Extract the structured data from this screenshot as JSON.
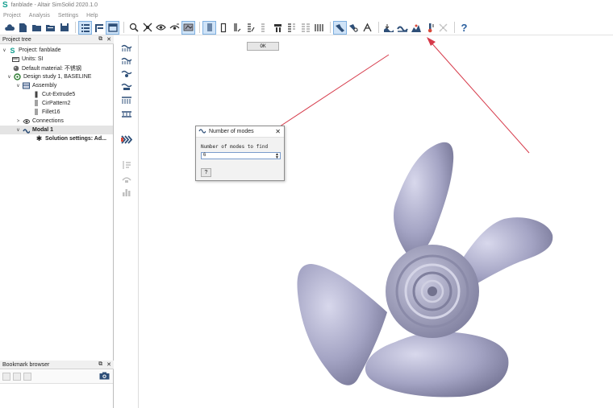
{
  "window": {
    "title": "fanblade - Altair SimSolid 2020.1.0"
  },
  "menu": [
    "Project",
    "Analysis",
    "Settings",
    "Help"
  ],
  "colors": {
    "accent": "#2a5f9e",
    "model": "#a4a4c4",
    "arrow": "#d63a4a",
    "selection": "#cfe3f7"
  },
  "panels": {
    "project_tree_title": "Project tree",
    "bookmark_title": "Bookmark browser",
    "float_glyph": "⧉",
    "close_glyph": "✕"
  },
  "tree": [
    {
      "label": "Project: fanblade",
      "icon": "simsolid-logo-icon",
      "twisty": "∨"
    },
    {
      "label": "Units: SI",
      "icon": "units-icon",
      "twisty": ""
    },
    {
      "label": "Default material: 不锈钢",
      "icon": "material-icon",
      "twisty": ""
    },
    {
      "label": "Design study 1, BASELINE",
      "icon": "design-study-icon",
      "twisty": "∨"
    },
    {
      "label": "Assembly",
      "icon": "assembly-icon",
      "twisty": "∨"
    },
    {
      "label": "Cut-Extrude5",
      "icon": "part-icon",
      "twisty": ""
    },
    {
      "label": "CirPattern2",
      "icon": "part-icon",
      "twisty": ""
    },
    {
      "label": "Fillet16",
      "icon": "part-icon",
      "twisty": ""
    },
    {
      "label": "Connections",
      "icon": "connections-icon",
      "twisty": ">"
    },
    {
      "label": "Modal 1",
      "icon": "modal-icon",
      "twisty": "∨"
    },
    {
      "label": "Solution settings: Ad...",
      "icon": "gear-icon",
      "twisty": ""
    }
  ],
  "dialog": {
    "title": "Number of modes",
    "label": "Number of modes to find",
    "value": "6",
    "help_label": "?",
    "ok_label": "OK",
    "close_glyph": "✕"
  },
  "toolbar": {
    "help_label": "?"
  }
}
